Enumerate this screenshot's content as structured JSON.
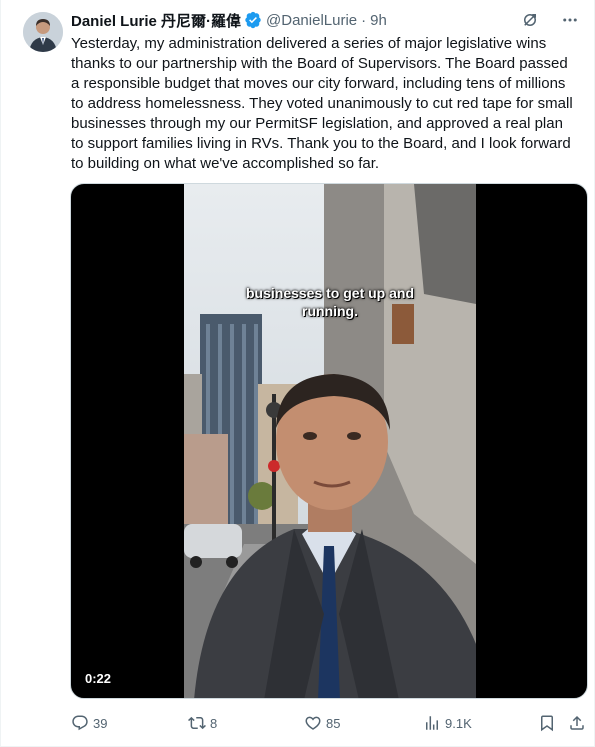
{
  "author": {
    "name": "Daniel Lurie 丹尼爾·羅偉",
    "handle": "@DanielLurie",
    "separator": "·",
    "time": "9h",
    "verified_color": "#1d9bf0"
  },
  "tweet": {
    "text": "Yesterday, my administration delivered a series of major legislative wins\nthanks to our partnership with the Board of Supervisors. The Board passed\na responsible budget that moves our city forward, including tens of millions\nto address homelessness. They voted unanimously to cut red tape for small\nbusinesses through my our PermitSF legislation, and approved a real plan\nto support families living in RVs. Thank you to the Board, and I look forward\nto building on what we've accomplished so far."
  },
  "media": {
    "caption": "businesses to get up and\nrunning.",
    "duration": "0:22"
  },
  "actions": {
    "replies": "39",
    "retweets": "8",
    "likes": "85",
    "views": "9.1K"
  },
  "icons": {
    "grok": "grok-icon",
    "more": "more-icon",
    "reply": "reply-icon",
    "retweet": "retweet-icon",
    "like": "like-icon",
    "views": "views-icon",
    "bookmark": "bookmark-icon",
    "share": "share-icon"
  },
  "colors": {
    "text": "#0f1419",
    "secondary": "#536471",
    "accent": "#1d9bf0"
  }
}
